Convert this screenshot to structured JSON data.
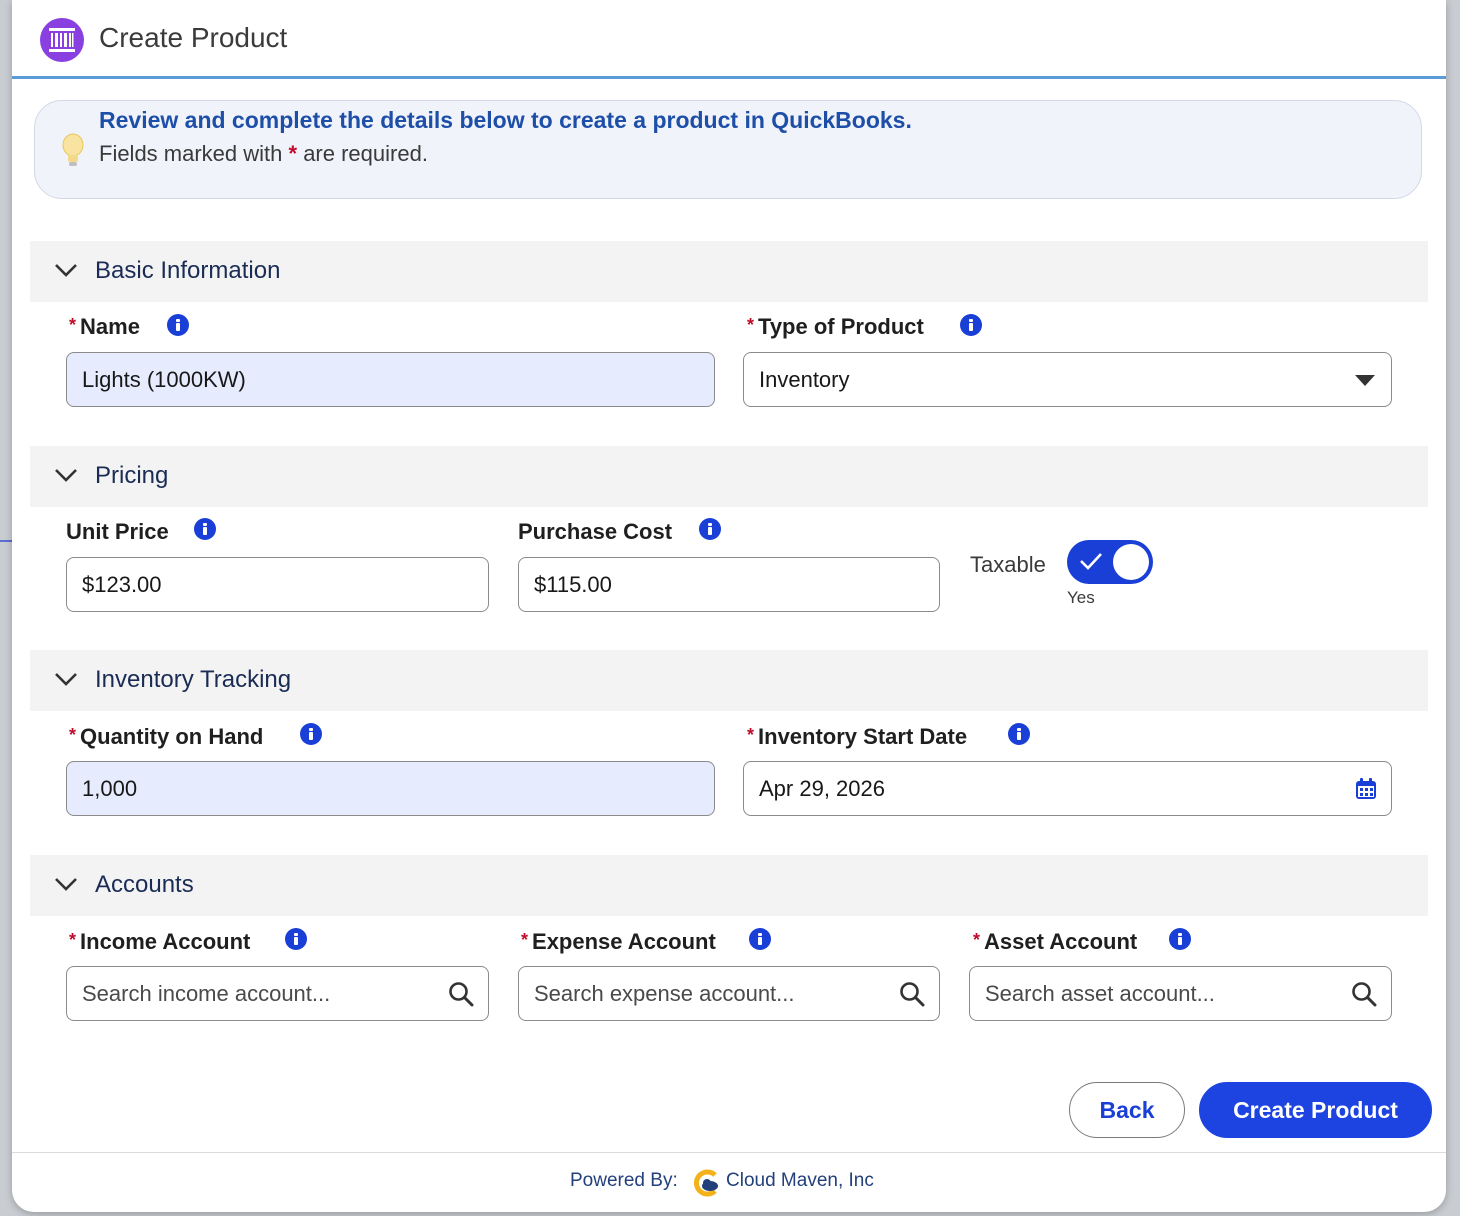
{
  "header": {
    "title": "Create Product",
    "icon": "barcode-icon"
  },
  "notice": {
    "headline": "Review and complete the details below to create a product in QuickBooks.",
    "text_before": "Fields marked with ",
    "star": "*",
    "text_after": " are required."
  },
  "sections": {
    "basic": "Basic Information",
    "pricing": "Pricing",
    "inventory": "Inventory Tracking",
    "accounts": "Accounts"
  },
  "required_mark": "*",
  "fields": {
    "name": {
      "label": "Name",
      "value": "Lights (1000KW)"
    },
    "type": {
      "label": "Type of Product",
      "value": "Inventory"
    },
    "unit_price": {
      "label": "Unit Price",
      "value": "$123.00"
    },
    "purchase_cost": {
      "label": "Purchase Cost",
      "value": "$115.00"
    },
    "taxable": {
      "label": "Taxable",
      "state": "Yes",
      "on": true
    },
    "qty": {
      "label": "Quantity on Hand",
      "value": "1,000"
    },
    "start_date": {
      "label": "Inventory Start Date",
      "value": "Apr 29, 2026"
    },
    "income": {
      "label": "Income Account",
      "placeholder": "Search income account..."
    },
    "expense": {
      "label": "Expense Account",
      "placeholder": "Search expense account..."
    },
    "asset": {
      "label": "Asset Account",
      "placeholder": "Search asset account..."
    }
  },
  "buttons": {
    "back": "Back",
    "create": "Create Product"
  },
  "footer": {
    "powered": "Powered By:",
    "company": "Cloud Maven, Inc"
  },
  "colors": {
    "accent": "#1d44e0",
    "required": "#c00d2c",
    "filled_bg": "#e6ecfd",
    "app_icon": "#8a3fe0"
  }
}
